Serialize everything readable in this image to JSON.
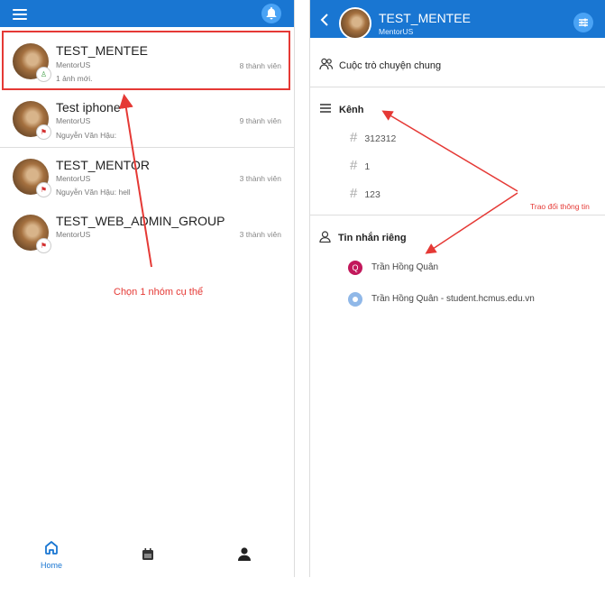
{
  "left": {
    "groups": [
      {
        "name": "TEST_MENTEE",
        "org": "MentorUS",
        "last": "1 ảnh mới.",
        "count": "8 thành viên"
      },
      {
        "name": "Test iphone",
        "org": "MentorUS",
        "last": "Nguyễn Văn Hậu:",
        "count": "9 thành viên"
      },
      {
        "name": "TEST_MENTOR",
        "org": "MentorUS",
        "last": "Nguyễn Văn Hậu: hell",
        "count": "3 thành viên"
      },
      {
        "name": "TEST_WEB_ADMIN_GROUP",
        "org": "MentorUS",
        "last": "",
        "count": "3 thành viên"
      }
    ],
    "annotation": "Chọn 1 nhóm cụ thể",
    "nav": {
      "home_label": "Home"
    }
  },
  "right": {
    "title": "TEST_MENTEE",
    "subtitle": "MentorUS",
    "general_chat": "Cuộc trò chuyện chung",
    "channels_header": "Kênh",
    "channels": [
      "312312",
      "1",
      "123"
    ],
    "private_header": "Tin nhắn riêng",
    "dms": [
      {
        "initial": "Q",
        "name": "Trần Hồng Quân",
        "color": "#c2185b"
      },
      {
        "initial": "",
        "name": "Trần Hồng Quân - student.hcmus.edu.vn",
        "color": "#90b8e8"
      }
    ],
    "annotation": "Trao đổi thông tin"
  },
  "colors": {
    "primary": "#1976d2",
    "annotation": "#e53935"
  }
}
